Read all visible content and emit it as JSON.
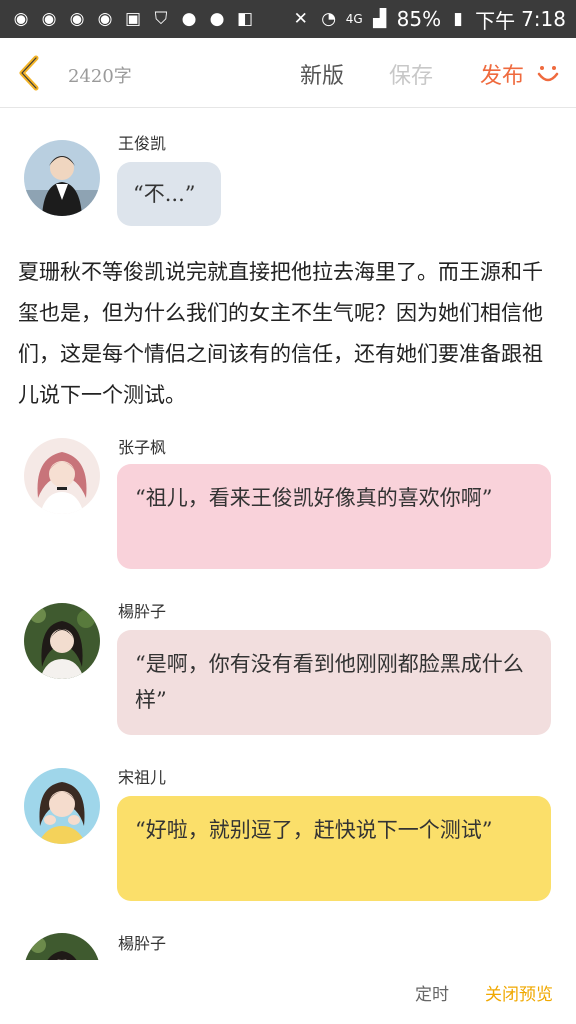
{
  "status_bar": {
    "battery": "85%",
    "signal": "4G",
    "time_prefix": "下午",
    "time": "7:18"
  },
  "header": {
    "word_count": "2420字",
    "new_version_label": "新版",
    "save_label": "保存",
    "publish_label": "发布"
  },
  "messages": [
    {
      "sender": "王俊凯",
      "text": "“不...”",
      "bubble_color": "#dde4ec"
    },
    {
      "sender": "张子枫",
      "text": "“祖儿，看来王俊凯好像真的喜欢你啊”",
      "bubble_color": "#f9d2da"
    },
    {
      "sender": "楊肸子",
      "text": "“是啊，你有没有看到他刚刚都脸黑成什么样”",
      "bubble_color": "#f2dede"
    },
    {
      "sender": "宋祖儿",
      "text": "“好啦，就别逗了，赶快说下一个测试”",
      "bubble_color": "#fbdf6a"
    },
    {
      "sender": "楊肸子"
    }
  ],
  "narration": "夏珊秋不等俊凯说完就直接把他拉去海里了。而王源和千玺也是，但为什么我们的女主不生气呢？因为她们相信他们，这是每个情侣之间该有的信任，还有她们要准备跟祖儿说下一个测试。",
  "bottom_bar": {
    "timer_label": "定时",
    "close_preview_label": "关闭预览"
  },
  "colors": {
    "accent_orange": "#ef6a3e",
    "accent_yellow": "#f0a800",
    "back_icon": "#f3b428"
  }
}
